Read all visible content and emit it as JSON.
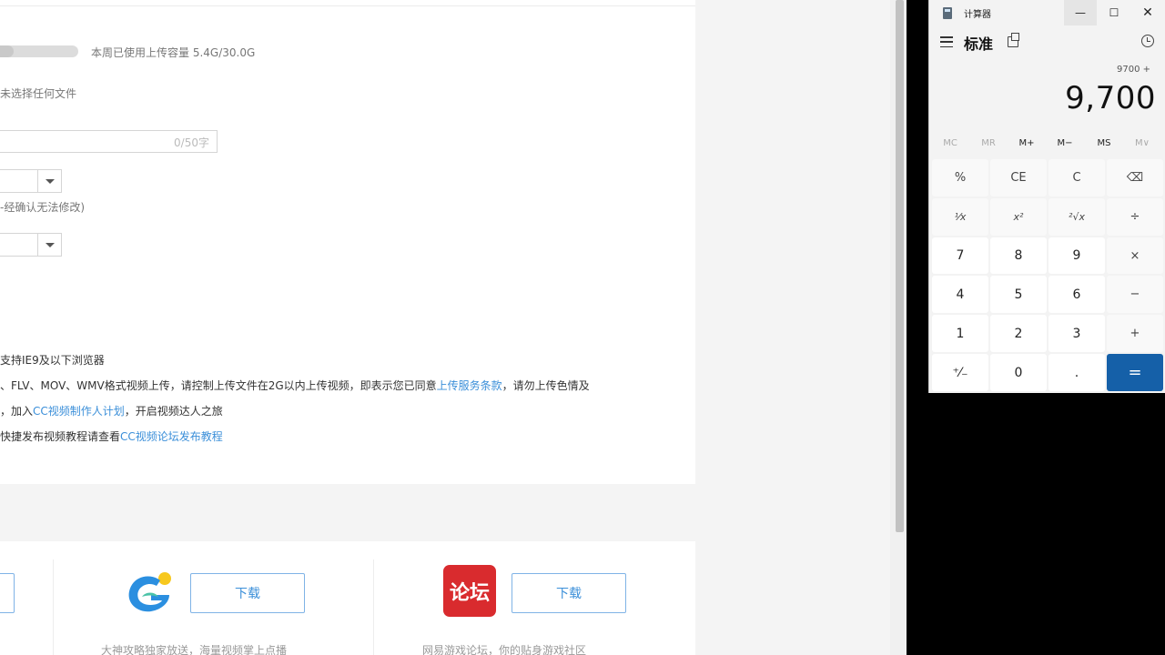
{
  "upload_page": {
    "capacity_text": "本周已使用上传容量 5.4G/30.0G",
    "capacity_used_fraction": 0.18,
    "no_file_text": "未选择任何文件",
    "title_counter": "0/50字",
    "confirm_note": "-经确认无法修改)",
    "notice_ie": "支持IE9及以下浏览器",
    "notice_format_prefix": "、FLV、MOV、WMV格式视频上传，请控制上传文件在2G以内上传视频，即表示您已同意",
    "notice_format_link": "上传服务条款",
    "notice_format_suffix": "，请勿上传色情及",
    "notice_join_prefix": "，加入",
    "notice_join_link": "CC视频制作人计划",
    "notice_join_suffix": "，开启视频达人之旅",
    "notice_tutorial_prefix": "快捷发布视频教程请查看",
    "notice_tutorial_link": "CC视频论坛发布教程"
  },
  "downloads": [
    {
      "button": "下载",
      "desc": "大神攻略独家放送，海量视频掌上点播",
      "logo_text": "dashen-app-logo"
    },
    {
      "button": "下载",
      "desc": "网易游戏论坛，你的贴身游戏社区",
      "logo_text": "论坛"
    }
  ],
  "calculator": {
    "title": "计算器",
    "mode": "标准",
    "expression": "9700 +",
    "display": "9,700",
    "memory": [
      "MC",
      "MR",
      "M+",
      "M−",
      "MS",
      "M∨"
    ],
    "keys": [
      "%",
      "CE",
      "C",
      "⌫",
      "¹⁄x",
      "x²",
      "²√x",
      "÷",
      "7",
      "8",
      "9",
      "×",
      "4",
      "5",
      "6",
      "−",
      "1",
      "2",
      "3",
      "+",
      "⁺⁄₋",
      "0",
      ".",
      "="
    ],
    "window_buttons": {
      "minimize": "—",
      "maximize": "☐",
      "close": "✕"
    }
  }
}
